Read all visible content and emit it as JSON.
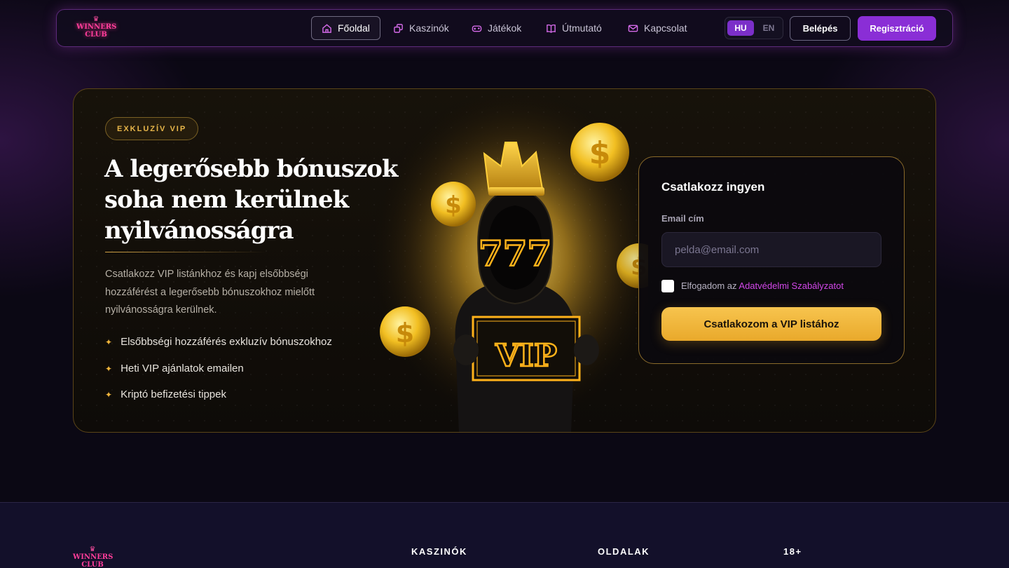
{
  "brand": {
    "logo_line1": "WINNERS",
    "logo_line2": "CLUB"
  },
  "nav": {
    "items": [
      {
        "label": "Főoldal",
        "icon": "home-icon",
        "active": true
      },
      {
        "label": "Kaszinók",
        "icon": "dice-icon"
      },
      {
        "label": "Játékok",
        "icon": "gamepad-icon"
      },
      {
        "label": "Útmutató",
        "icon": "book-icon"
      },
      {
        "label": "Kapcsolat",
        "icon": "mail-icon"
      }
    ],
    "lang_hu": "HU",
    "lang_en": "EN",
    "login_label": "Belépés",
    "register_label": "Regisztráció"
  },
  "hero": {
    "badge": "EXKLUZÍV VIP",
    "title": "A legerősebb bónuszok soha nem kerülnek nyilvánosságra",
    "description": "Csatlakozz VIP listánkhoz és kapj elsőbbségi hozzáférést a legerősebb bónuszokhoz mielőtt nyilvánosságra kerülnek.",
    "features": [
      "Elsőbbségi hozzáférés exkluzív bónuszokhoz",
      "Heti VIP ajánlatok emailen",
      "Kriptó befizetési tippek"
    ],
    "illustration": {
      "mask_text": "777",
      "sign_text": "VIP"
    }
  },
  "form": {
    "title": "Csatlakozz ingyen",
    "email_label": "Email cím",
    "email_placeholder": "pelda@email.com",
    "email_value": "",
    "consent_prefix": "Elfogadom az",
    "consent_link": "Adatvédelmi Szabályzatot",
    "submit_label": "Csatlakozom a VIP listához"
  },
  "footer": {
    "col1": "KASZINÓK",
    "col2": "OLDALAK",
    "col3": "18+"
  },
  "colors": {
    "accent_purple": "#8a2ed6",
    "accent_gold": "#f0b53c",
    "link_pink": "#d147e8"
  }
}
